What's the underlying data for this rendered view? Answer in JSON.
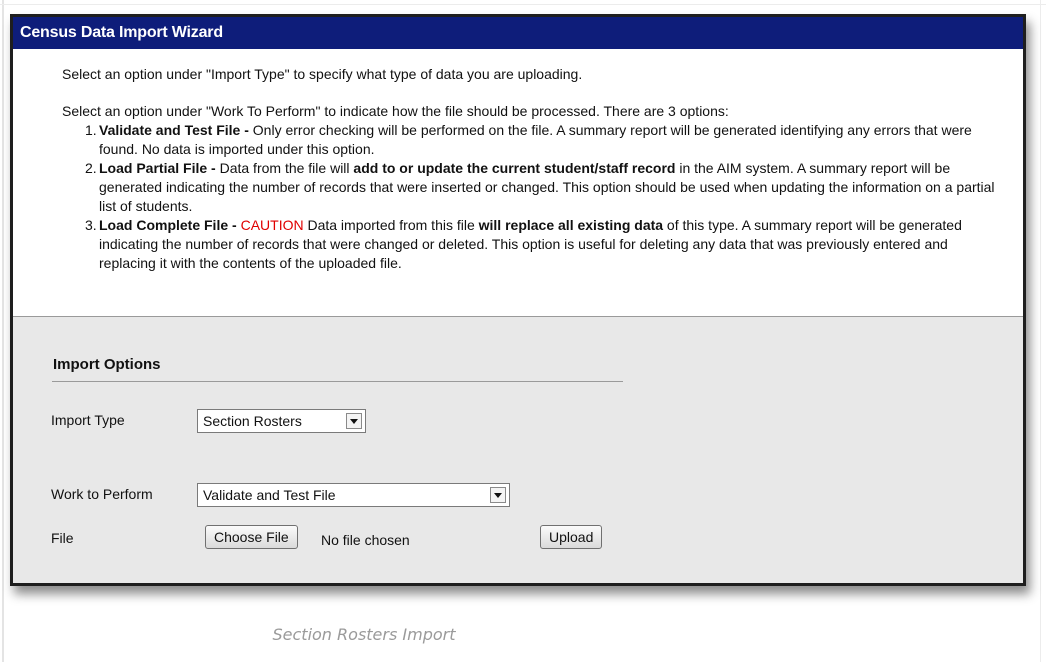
{
  "window": {
    "title": "Census Data Import Wizard"
  },
  "instructions": {
    "intro1": "Select an option under \"Import Type\" to specify what type of data you are uploading.",
    "intro2": "Select an option under \"Work To Perform\" to indicate how the file should be processed. There are 3 options:",
    "steps": [
      {
        "number": "1.",
        "title": "Validate and Test File -",
        "text": " Only error checking will be performed on the file. A summary report will be generated identifying any errors that were found. No data is imported under this option."
      },
      {
        "number": "2.",
        "title": "Load Partial File -",
        "text_a": " Data from the file will ",
        "bold": "add to or update the current student/staff record",
        "text_b": " in the AIM system. A summary report will be generated indicating the number of records that were inserted or changed. This option should be used when updating the information on a partial list of students."
      },
      {
        "number": "3.",
        "title": "Load Complete File -",
        "caution": "CAUTION",
        "text_a": " Data imported from this file ",
        "bold": "will replace all existing data",
        "text_b": " of this type. A summary report will be generated indicating the number of records that were changed or deleted. This option is useful for deleting any data that was previously entered and replacing it with the contents of the uploaded file."
      }
    ]
  },
  "options": {
    "heading": "Import Options",
    "import_type_label": "Import Type",
    "import_type_value": "Section Rosters",
    "work_label": "Work to Perform",
    "work_value": "Validate and Test File",
    "file_label": "File",
    "choose_file": "Choose File",
    "no_file": "No file chosen",
    "upload": "Upload"
  },
  "caption": "Section Rosters Import"
}
